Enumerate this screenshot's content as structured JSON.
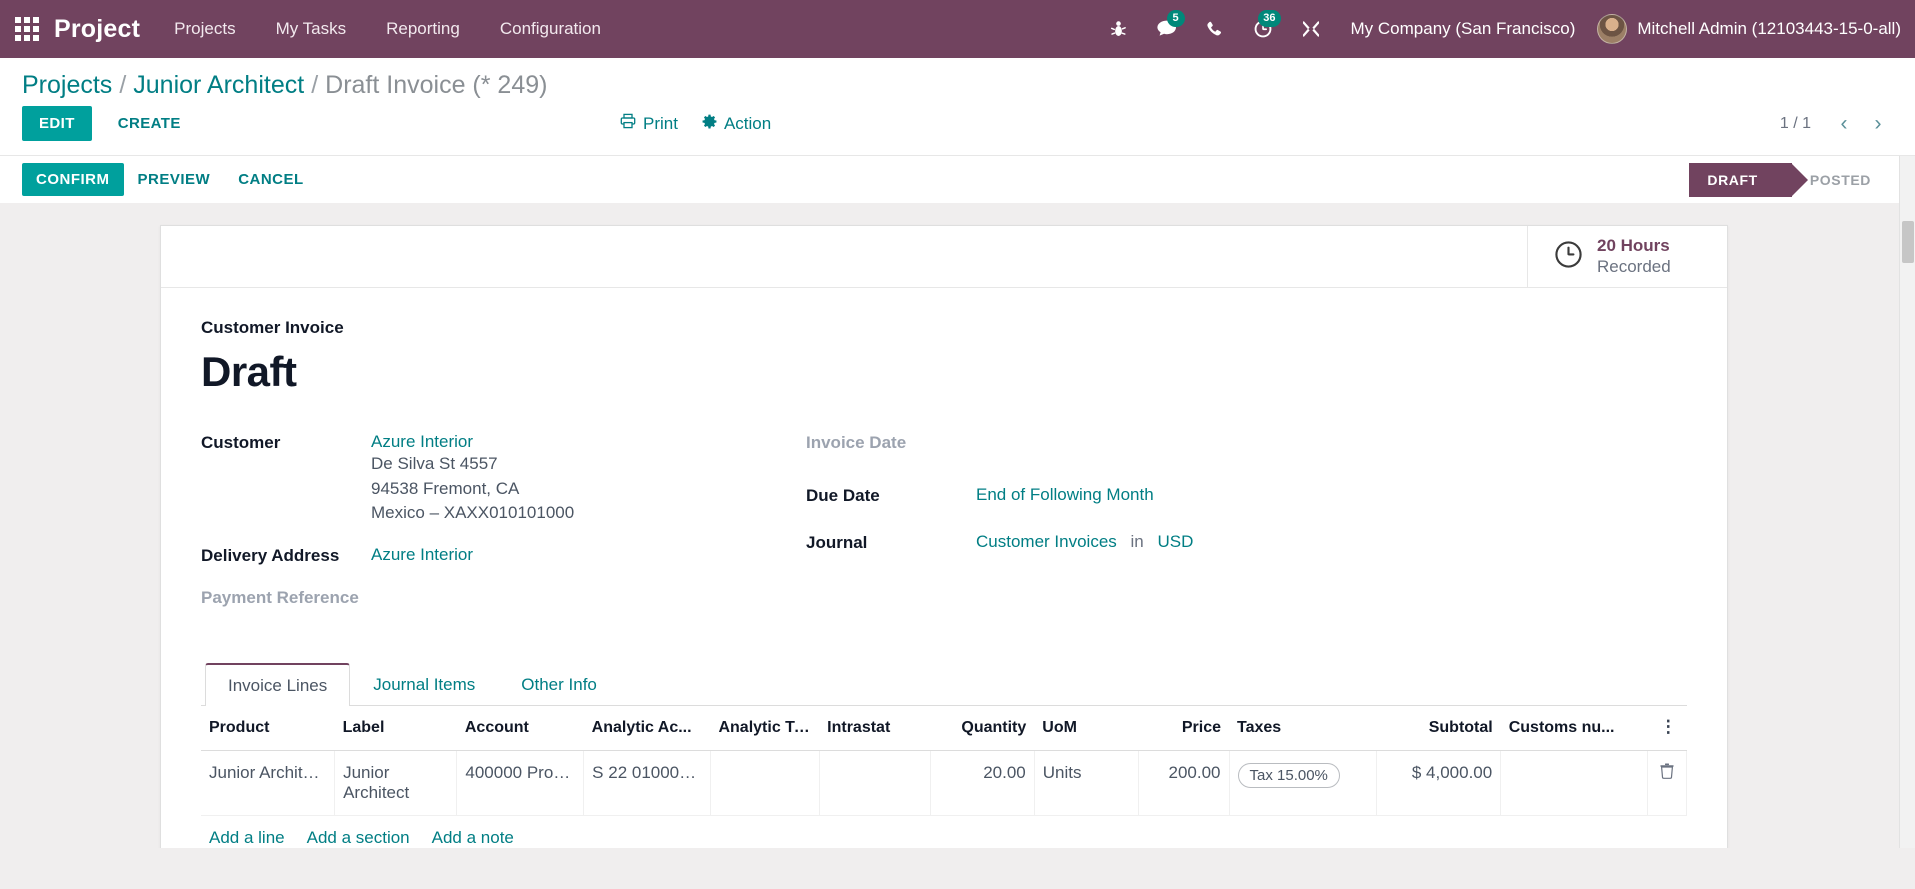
{
  "navbar": {
    "apps_icon": "apps-grid-icon",
    "brand": "Project",
    "menu": [
      {
        "label": "Projects"
      },
      {
        "label": "My Tasks"
      },
      {
        "label": "Reporting"
      },
      {
        "label": "Configuration"
      }
    ],
    "sys_icons": [
      {
        "name": "bug-icon",
        "badge": ""
      },
      {
        "name": "messages-icon",
        "badge": "5"
      },
      {
        "name": "phone-icon",
        "badge": ""
      },
      {
        "name": "activities-clock-icon",
        "badge": "36"
      },
      {
        "name": "tools-icon",
        "badge": ""
      }
    ],
    "company": "My Company (San Francisco)",
    "user": "Mitchell Admin (12103443-15-0-all)",
    "brand_color": "#71435f",
    "badge_color": "#00887a"
  },
  "breadcrumb": {
    "root": "Projects",
    "parent": "Junior Architect",
    "current": "Draft Invoice (* 249)",
    "separator": "/"
  },
  "control_panel": {
    "edit_label": "EDIT",
    "create_label": "CREATE",
    "print_label": "Print",
    "action_label": "Action",
    "pager_value": "1 / 1",
    "prev_icon": "chevron-left-icon",
    "next_icon": "chevron-right-icon"
  },
  "statusbar": {
    "buttons": [
      {
        "label": "CONFIRM",
        "primary": true
      },
      {
        "label": "PREVIEW",
        "primary": false
      },
      {
        "label": "CANCEL",
        "primary": false
      }
    ],
    "stages": [
      {
        "label": "DRAFT",
        "active": true
      },
      {
        "label": "POSTED",
        "active": false
      }
    ],
    "active_color": "#71435f"
  },
  "smart_buttons": [
    {
      "icon": "clock-icon",
      "value": "20 Hours",
      "label": "Recorded"
    }
  ],
  "sheet": {
    "doc_type": "Customer Invoice",
    "title": "Draft",
    "left_fields": [
      {
        "label": "Customer",
        "muted": false,
        "link": "Azure Interior",
        "lines": [
          "De Silva St 4557",
          "94538 Fremont, CA",
          "Mexico – XAXX010101000"
        ]
      },
      {
        "label": "Delivery Address",
        "muted": false,
        "link": "Azure Interior",
        "lines": []
      },
      {
        "label": "Payment Reference",
        "muted": true,
        "link": "",
        "lines": []
      }
    ],
    "right_fields": [
      {
        "label": "Invoice Date",
        "muted": true,
        "value": "",
        "value_link": ""
      },
      {
        "label": "Due Date",
        "muted": false,
        "value": "",
        "value_link": "End of Following Month"
      },
      {
        "label": "Journal",
        "muted": false,
        "value_link": "Customer Invoices",
        "separator": "in",
        "currency": "USD"
      }
    ]
  },
  "notebook": {
    "tabs": [
      {
        "label": "Invoice Lines",
        "active": true
      },
      {
        "label": "Journal Items",
        "active": false
      },
      {
        "label": "Other Info",
        "active": false
      }
    ],
    "options_icon": "vertical-dots-icon",
    "columns": [
      {
        "label": "Product",
        "align": "left"
      },
      {
        "label": "Label",
        "align": "left"
      },
      {
        "label": "Account",
        "align": "left"
      },
      {
        "label": "Analytic Ac...",
        "align": "left"
      },
      {
        "label": "Analytic Ta...",
        "align": "left"
      },
      {
        "label": "Intrastat",
        "align": "left"
      },
      {
        "label": "Quantity",
        "align": "right"
      },
      {
        "label": "UoM",
        "align": "left"
      },
      {
        "label": "Price",
        "align": "right"
      },
      {
        "label": "Taxes",
        "align": "left"
      },
      {
        "label": "Subtotal",
        "align": "right"
      },
      {
        "label": "Customs nu...",
        "align": "left"
      }
    ],
    "rows": [
      {
        "product": "Junior Archite...",
        "label": "Junior Architect",
        "account": "400000 Produ...",
        "analytic_account": "S 22 0100095...",
        "analytic_tags": "",
        "intrastat": "",
        "quantity": "20.00",
        "uom": "Units",
        "price": "200.00",
        "taxes": "Tax 15.00%",
        "subtotal": "$ 4,000.00",
        "customs_number": "",
        "delete_icon": "trash-icon"
      }
    ],
    "add_links": [
      {
        "label": "Add a line"
      },
      {
        "label": "Add a section"
      },
      {
        "label": "Add a note"
      }
    ]
  }
}
